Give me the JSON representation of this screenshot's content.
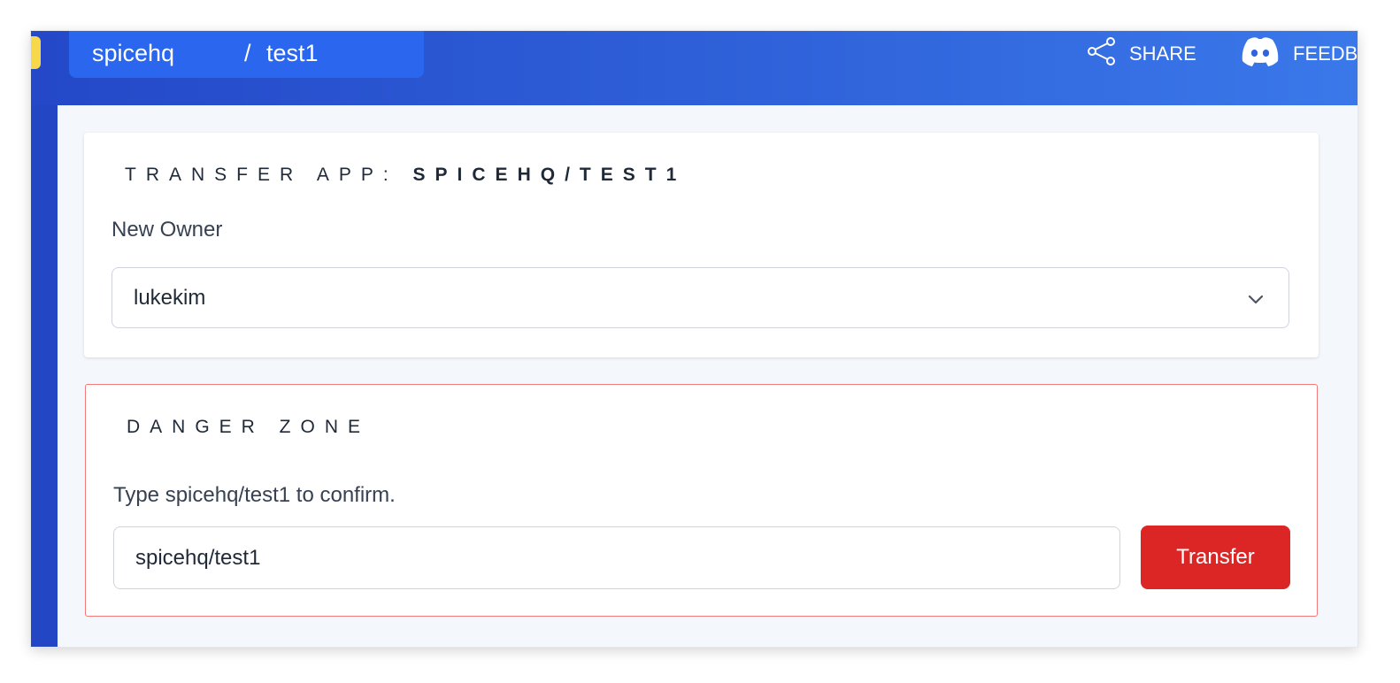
{
  "header": {
    "breadcrumb": {
      "org": "spicehq",
      "separator": "/",
      "app": "test1"
    },
    "share_label": "SHARE",
    "share_icon": "share-icon",
    "feedback_label": "FEEDBACK",
    "feedback_icon": "discord-icon"
  },
  "transfer_card": {
    "title_prefix": "TRANSFER APP: ",
    "title_app": "SPICEHQ/TEST1",
    "new_owner_label": "New Owner",
    "new_owner_value": "lukekim",
    "chevron_icon": "chevron-down-icon"
  },
  "danger_zone": {
    "title": "DANGER ZONE",
    "confirm_label": "Type spicehq/test1 to confirm.",
    "confirm_value": "spicehq/test1",
    "transfer_label": "Transfer"
  },
  "colors": {
    "header_start": "#2448c8",
    "header_end": "#3a78ea",
    "breadcrumb_bg": "#2b66ee",
    "danger_border": "#f17a7a",
    "transfer_button": "#dc2626",
    "page_bg": "#f4f7fb"
  }
}
